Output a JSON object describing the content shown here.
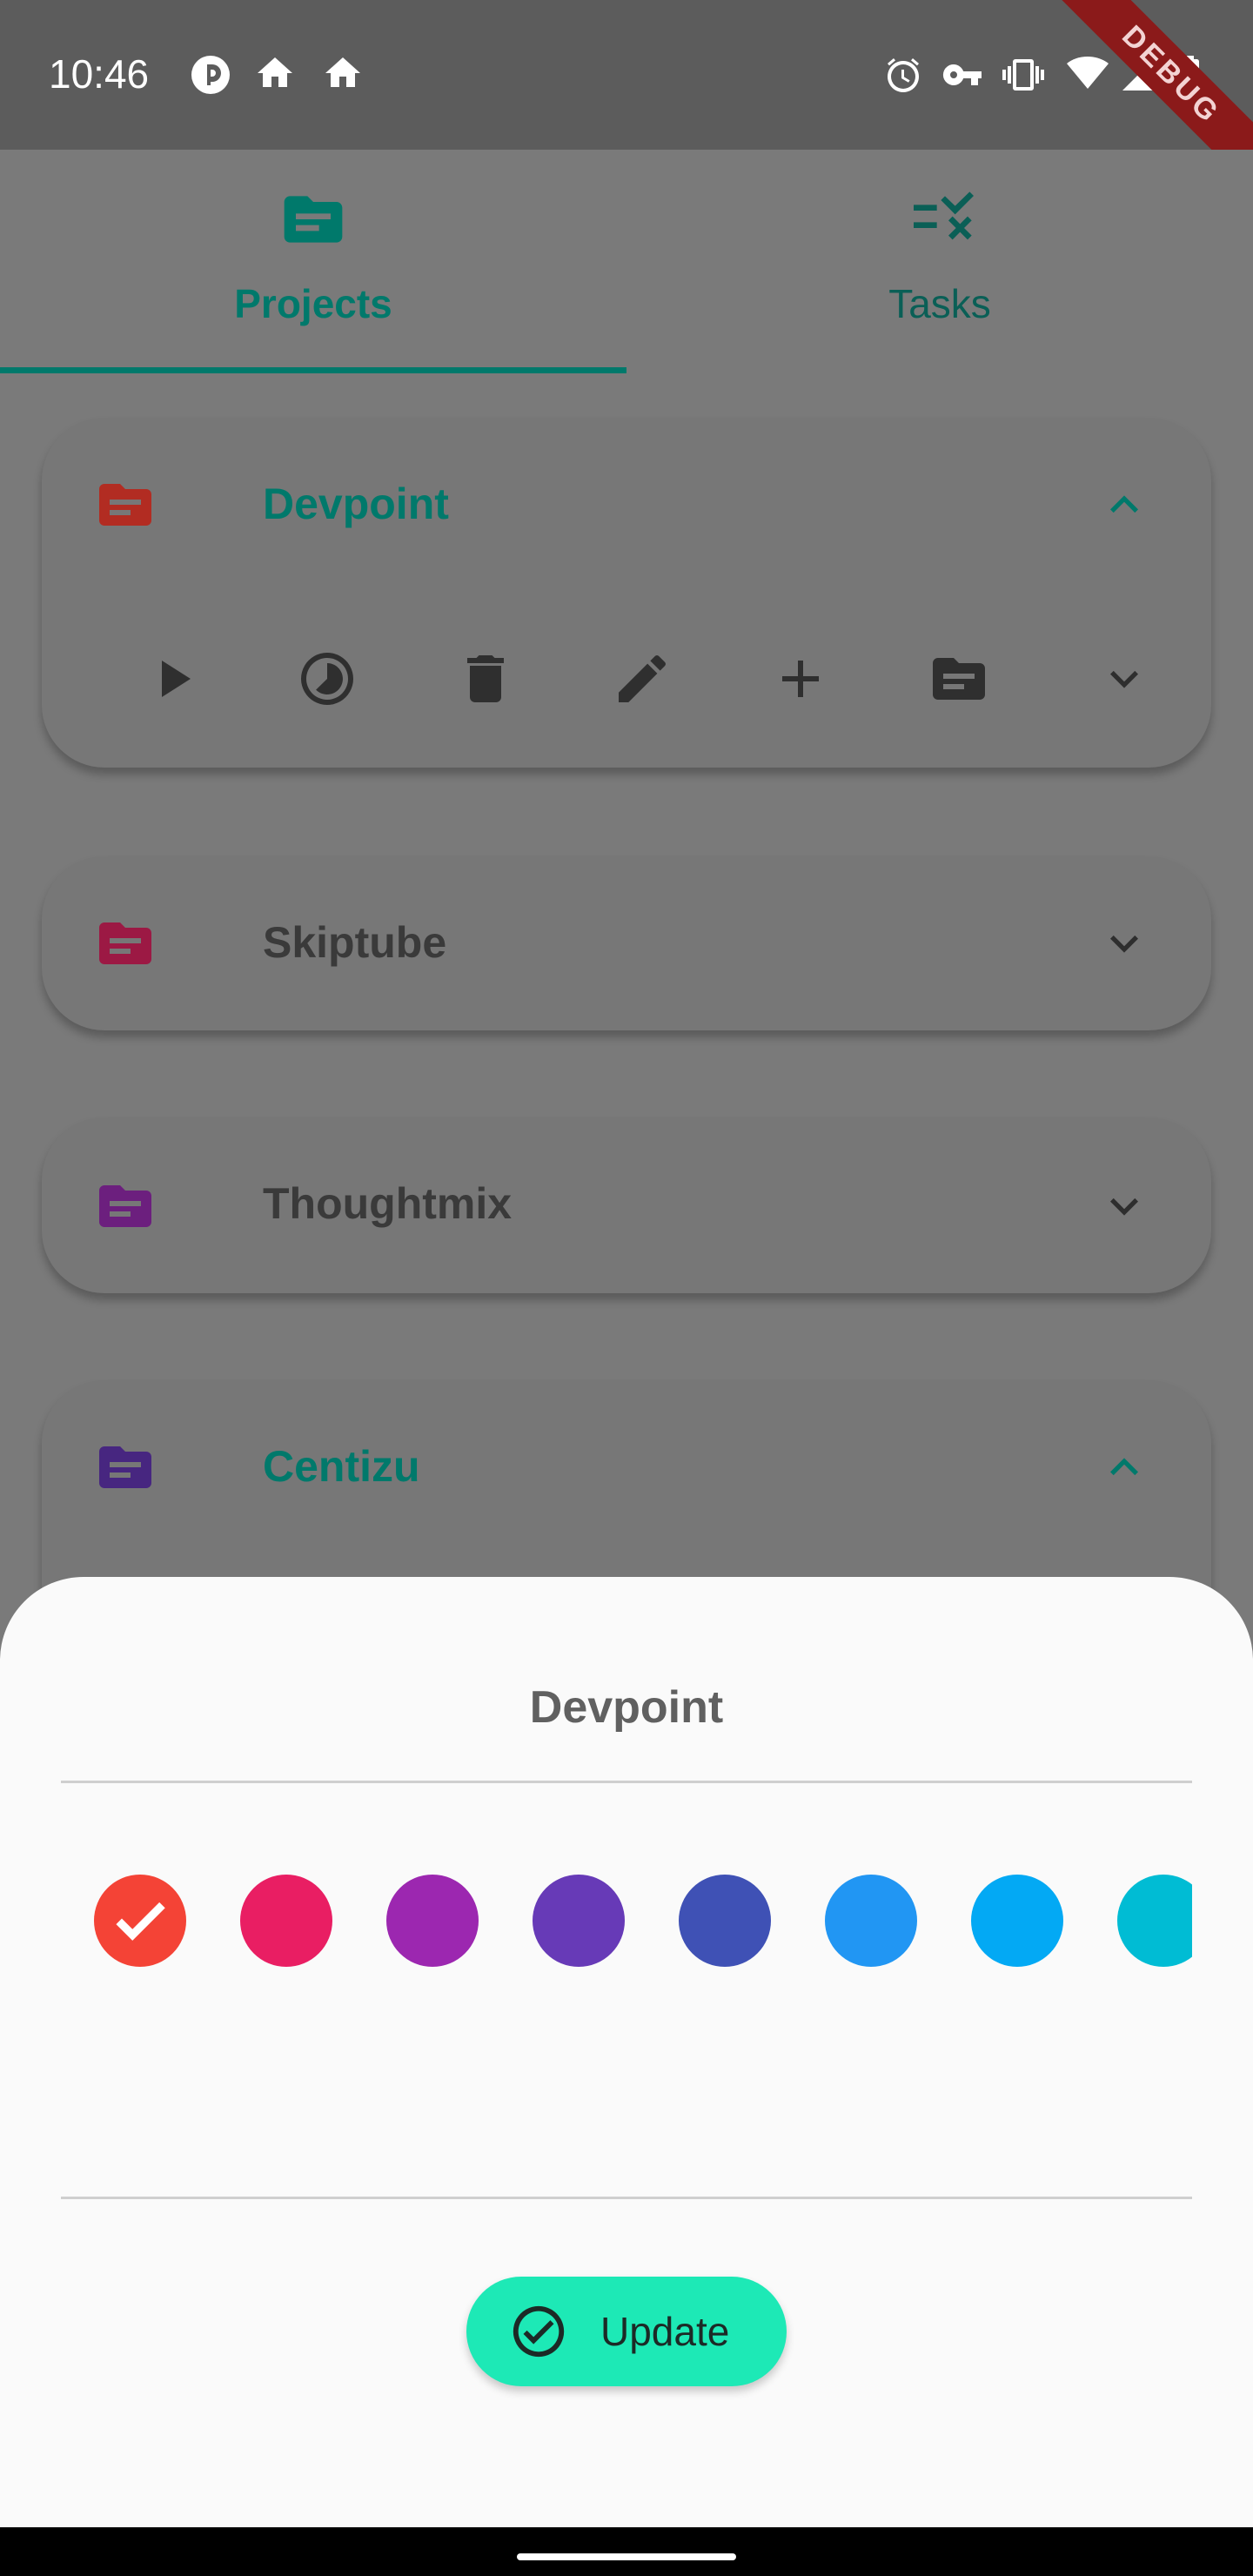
{
  "status_bar": {
    "time": "10:46",
    "left_icons": [
      "pocket-casts-icon",
      "home-icon",
      "home-icon"
    ],
    "right_icons": [
      "alarm-icon",
      "vpn-key-icon",
      "vibrate-icon",
      "wifi-icon",
      "signal-icon",
      "battery-charging-icon"
    ],
    "debug_banner": "DEBUG"
  },
  "tabs": [
    {
      "label": "Projects",
      "icon": "folder-icon",
      "selected": true
    },
    {
      "label": "Tasks",
      "icon": "tasks-check-icon",
      "selected": false
    }
  ],
  "projects": [
    {
      "name": "Devpoint",
      "folder_color": "#b22c22",
      "expanded": true,
      "actions": [
        "play-icon",
        "clock-icon",
        "delete-icon",
        "edit-icon",
        "add-icon",
        "folder-icon",
        "chevron-down-icon"
      ]
    },
    {
      "name": "Skiptube",
      "folder_color": "#9c1944",
      "expanded": false
    },
    {
      "name": "Thoughtmix",
      "folder_color": "#6c1f7e",
      "expanded": false
    },
    {
      "name": "Centizu",
      "folder_color": "#472680",
      "expanded": true
    }
  ],
  "sheet": {
    "title": "Devpoint",
    "colors": [
      "#f44336",
      "#e91e63",
      "#9c27b0",
      "#673ab7",
      "#3f51b5",
      "#2196f3",
      "#03a9f4",
      "#00bcd4"
    ],
    "selected_color": "#f44336",
    "update_label": "Update"
  },
  "accent_color": "#00796b"
}
